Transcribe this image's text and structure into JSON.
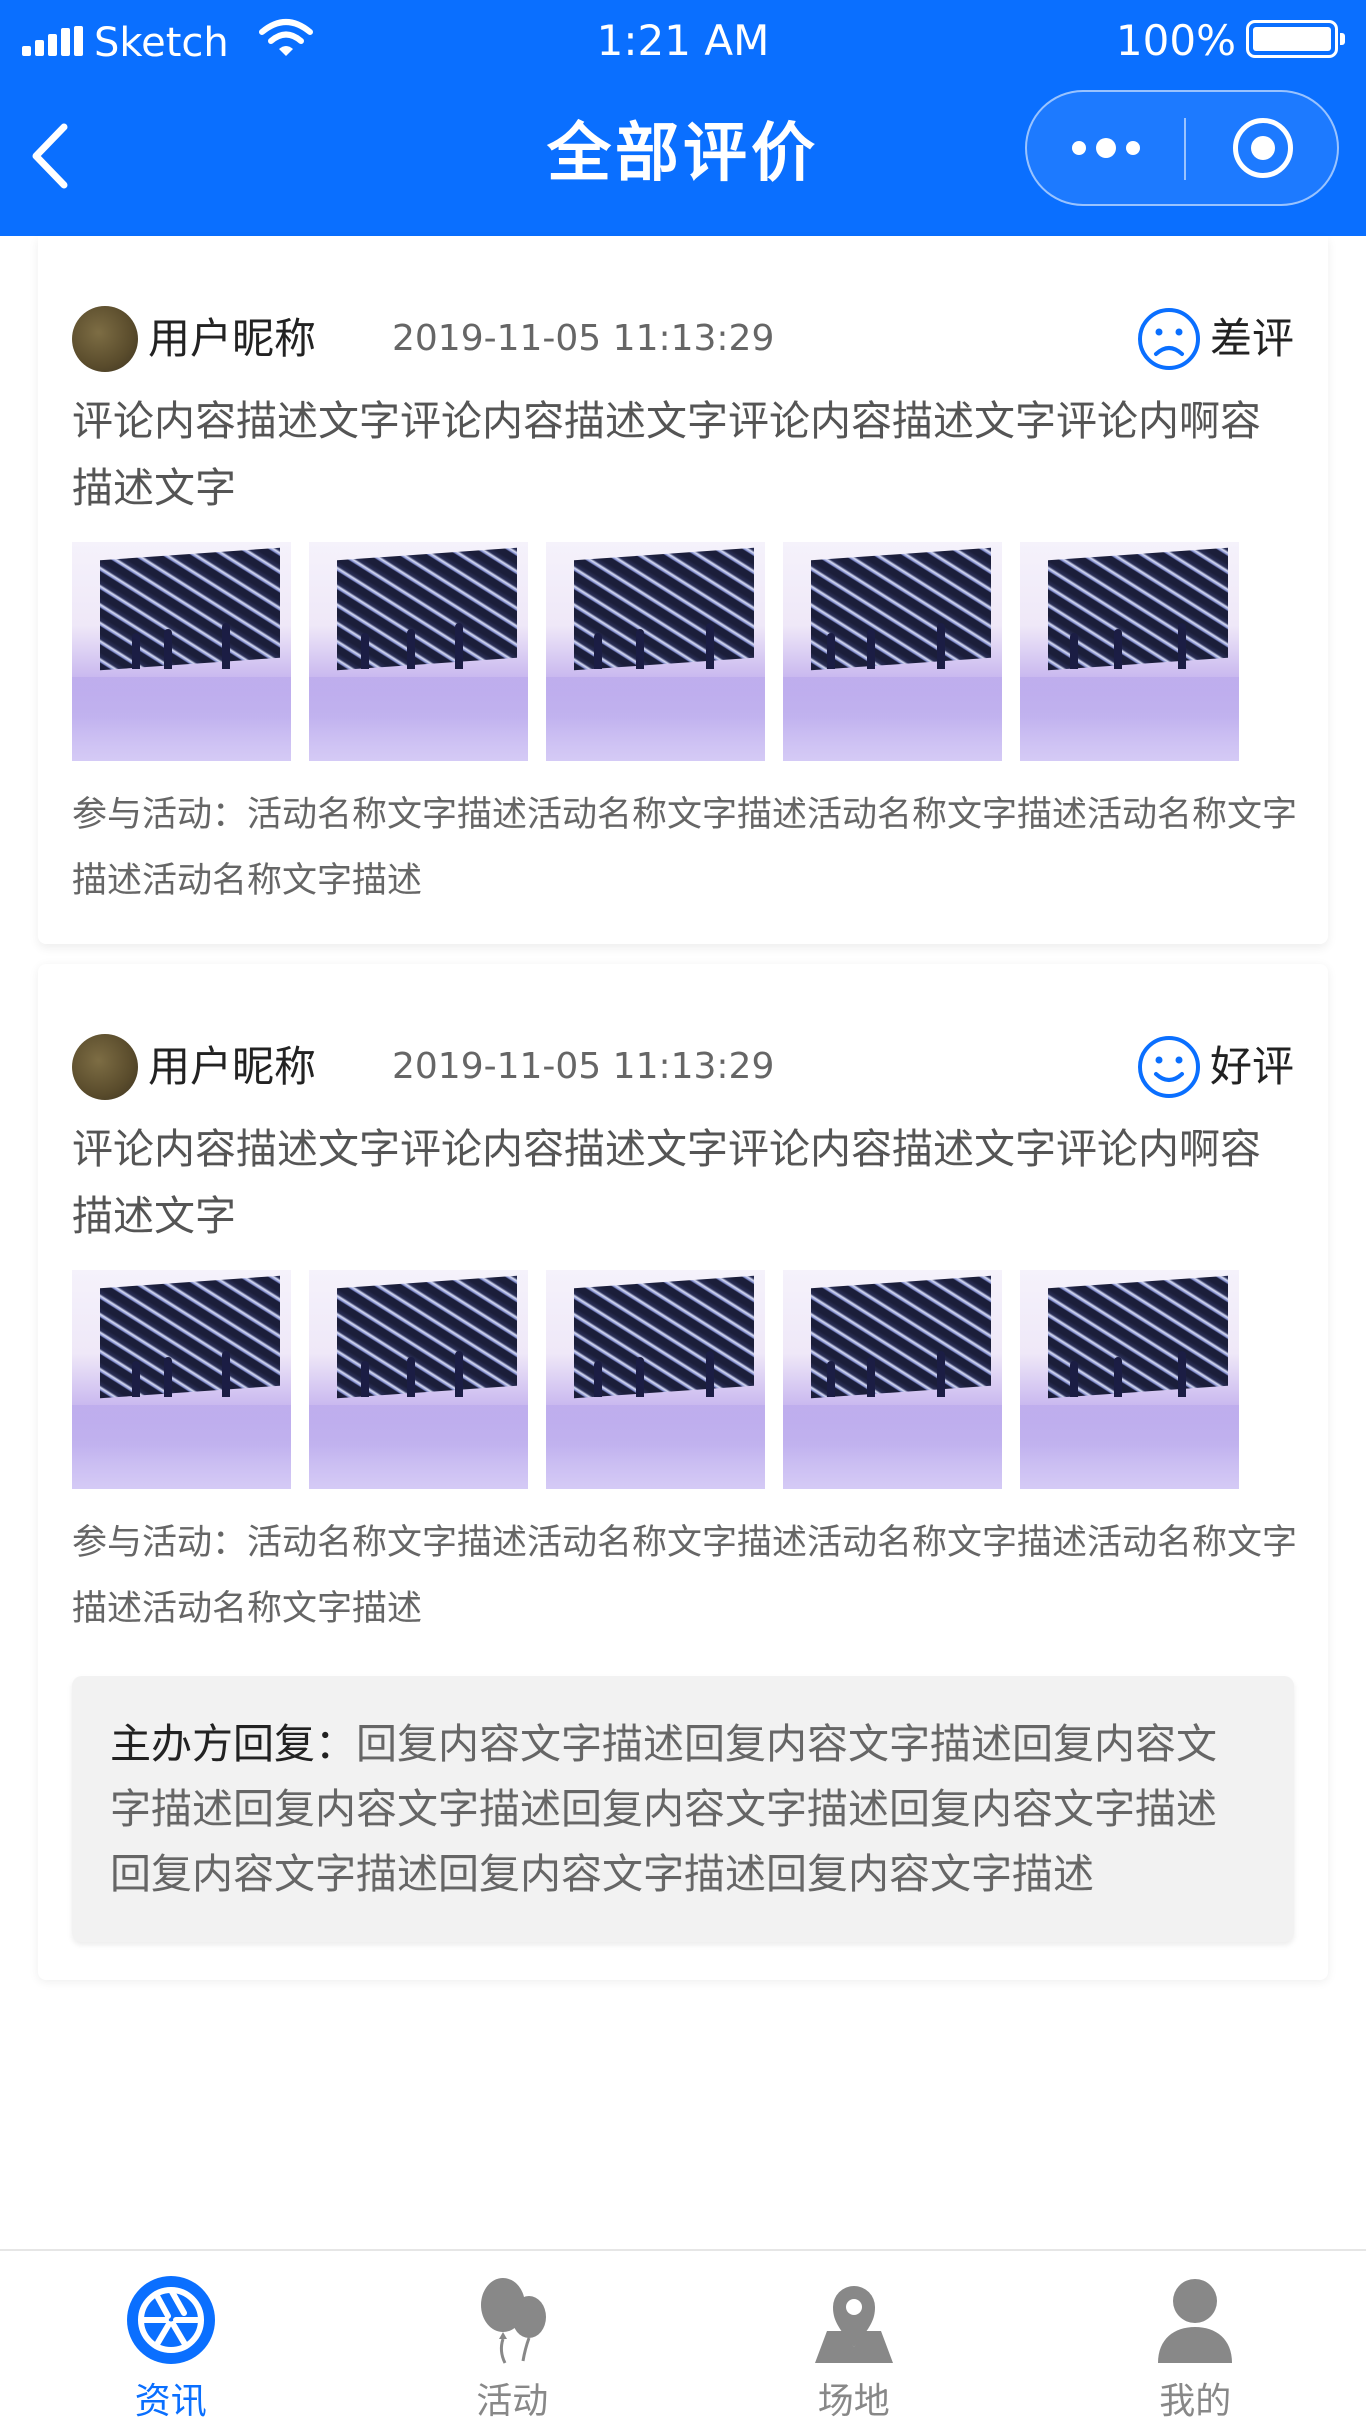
{
  "status_bar": {
    "carrier": "Sketch",
    "time": "1:21 AM",
    "battery": "100%"
  },
  "nav": {
    "title": "全部评价",
    "back_icon": "chevron-left-icon",
    "more_icon": "more-dots-icon",
    "close_icon": "target-circle-icon"
  },
  "colors": {
    "brand": "#0a6fff",
    "inactive_tab": "#888888",
    "reply_bg": "#f2f2f2"
  },
  "reviews": [
    {
      "user": "用户昵称",
      "datetime": "2019-11-05 11:13:29",
      "rating_label": "差评",
      "rating_icon": "sad-face-icon",
      "comment": "评论内容描述文字评论内容描述文字评论内容描述文字评论内啊容描述文字",
      "activity": "参与活动：活动名称文字描述活动名称文字描述活动名称文字描述活动名称文字描述活动名称文字描述"
    },
    {
      "user": "用户昵称",
      "datetime": "2019-11-05 11:13:29",
      "rating_label": "好评",
      "rating_icon": "smile-face-icon",
      "comment": "评论内容描述文字评论内容描述文字评论内容描述文字评论内啊容描述文字",
      "activity": "参与活动：活动名称文字描述活动名称文字描述活动名称文字描述活动名称文字描述活动名称文字描述",
      "reply_title": "主办方回复：",
      "reply": "回复内容文字描述回复内容文字描述回复内容文字描述回复内容文字描述回复内容文字描述回复内容文字描述回复内容文字描述回复内容文字描述回复内容文字描述"
    }
  ],
  "tabbar": {
    "items": [
      {
        "label": "资讯",
        "icon": "aperture-icon",
        "active": true
      },
      {
        "label": "活动",
        "icon": "balloons-icon",
        "active": false
      },
      {
        "label": "场地",
        "icon": "map-pin-icon",
        "active": false
      },
      {
        "label": "我的",
        "icon": "user-icon",
        "active": false
      }
    ]
  }
}
